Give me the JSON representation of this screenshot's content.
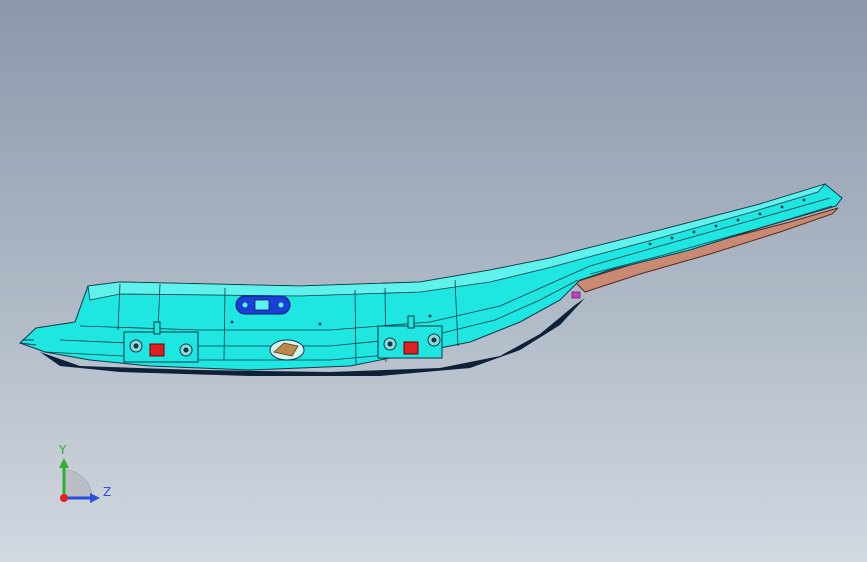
{
  "viewport": {
    "background_top": "#8b98aa",
    "background_bottom": "#d2d8e0"
  },
  "model": {
    "name_icon": "cad-part-frame-rail",
    "body_color": "#1fe6e0",
    "edge_color": "#0c3a4a",
    "shadow_color": "#0d2138",
    "flange_color": "#c98a74",
    "bracket_color": "#1b3fd6",
    "clip_color": "#e02020"
  },
  "triad": {
    "y_label": "Y",
    "z_label": "Z",
    "y_color": "#2fb02f",
    "z_color": "#2a4fd8",
    "origin_color": "#e02020"
  }
}
